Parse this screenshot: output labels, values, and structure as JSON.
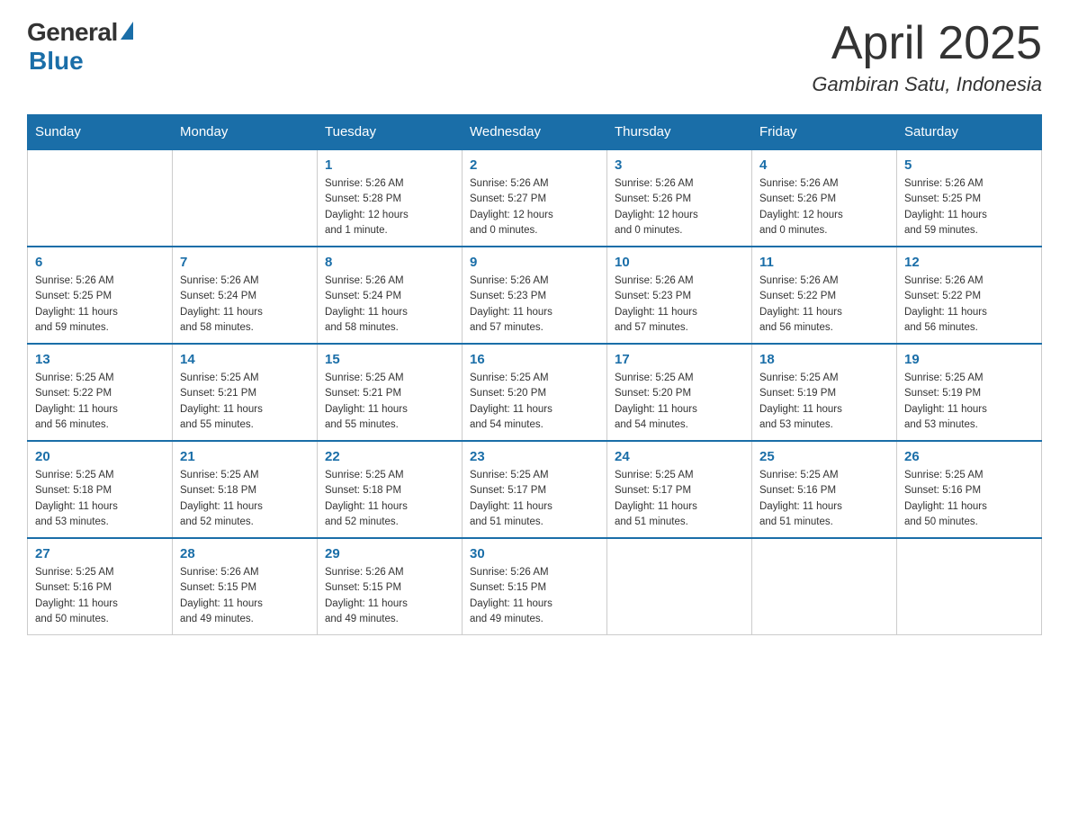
{
  "logo": {
    "general": "General",
    "blue": "Blue",
    "underline": "Blue"
  },
  "header": {
    "month": "April 2025",
    "location": "Gambiran Satu, Indonesia"
  },
  "weekdays": [
    "Sunday",
    "Monday",
    "Tuesday",
    "Wednesday",
    "Thursday",
    "Friday",
    "Saturday"
  ],
  "weeks": [
    [
      {
        "day": "",
        "info": ""
      },
      {
        "day": "",
        "info": ""
      },
      {
        "day": "1",
        "info": "Sunrise: 5:26 AM\nSunset: 5:28 PM\nDaylight: 12 hours\nand 1 minute."
      },
      {
        "day": "2",
        "info": "Sunrise: 5:26 AM\nSunset: 5:27 PM\nDaylight: 12 hours\nand 0 minutes."
      },
      {
        "day": "3",
        "info": "Sunrise: 5:26 AM\nSunset: 5:26 PM\nDaylight: 12 hours\nand 0 minutes."
      },
      {
        "day": "4",
        "info": "Sunrise: 5:26 AM\nSunset: 5:26 PM\nDaylight: 12 hours\nand 0 minutes."
      },
      {
        "day": "5",
        "info": "Sunrise: 5:26 AM\nSunset: 5:25 PM\nDaylight: 11 hours\nand 59 minutes."
      }
    ],
    [
      {
        "day": "6",
        "info": "Sunrise: 5:26 AM\nSunset: 5:25 PM\nDaylight: 11 hours\nand 59 minutes."
      },
      {
        "day": "7",
        "info": "Sunrise: 5:26 AM\nSunset: 5:24 PM\nDaylight: 11 hours\nand 58 minutes."
      },
      {
        "day": "8",
        "info": "Sunrise: 5:26 AM\nSunset: 5:24 PM\nDaylight: 11 hours\nand 58 minutes."
      },
      {
        "day": "9",
        "info": "Sunrise: 5:26 AM\nSunset: 5:23 PM\nDaylight: 11 hours\nand 57 minutes."
      },
      {
        "day": "10",
        "info": "Sunrise: 5:26 AM\nSunset: 5:23 PM\nDaylight: 11 hours\nand 57 minutes."
      },
      {
        "day": "11",
        "info": "Sunrise: 5:26 AM\nSunset: 5:22 PM\nDaylight: 11 hours\nand 56 minutes."
      },
      {
        "day": "12",
        "info": "Sunrise: 5:26 AM\nSunset: 5:22 PM\nDaylight: 11 hours\nand 56 minutes."
      }
    ],
    [
      {
        "day": "13",
        "info": "Sunrise: 5:25 AM\nSunset: 5:22 PM\nDaylight: 11 hours\nand 56 minutes."
      },
      {
        "day": "14",
        "info": "Sunrise: 5:25 AM\nSunset: 5:21 PM\nDaylight: 11 hours\nand 55 minutes."
      },
      {
        "day": "15",
        "info": "Sunrise: 5:25 AM\nSunset: 5:21 PM\nDaylight: 11 hours\nand 55 minutes."
      },
      {
        "day": "16",
        "info": "Sunrise: 5:25 AM\nSunset: 5:20 PM\nDaylight: 11 hours\nand 54 minutes."
      },
      {
        "day": "17",
        "info": "Sunrise: 5:25 AM\nSunset: 5:20 PM\nDaylight: 11 hours\nand 54 minutes."
      },
      {
        "day": "18",
        "info": "Sunrise: 5:25 AM\nSunset: 5:19 PM\nDaylight: 11 hours\nand 53 minutes."
      },
      {
        "day": "19",
        "info": "Sunrise: 5:25 AM\nSunset: 5:19 PM\nDaylight: 11 hours\nand 53 minutes."
      }
    ],
    [
      {
        "day": "20",
        "info": "Sunrise: 5:25 AM\nSunset: 5:18 PM\nDaylight: 11 hours\nand 53 minutes."
      },
      {
        "day": "21",
        "info": "Sunrise: 5:25 AM\nSunset: 5:18 PM\nDaylight: 11 hours\nand 52 minutes."
      },
      {
        "day": "22",
        "info": "Sunrise: 5:25 AM\nSunset: 5:18 PM\nDaylight: 11 hours\nand 52 minutes."
      },
      {
        "day": "23",
        "info": "Sunrise: 5:25 AM\nSunset: 5:17 PM\nDaylight: 11 hours\nand 51 minutes."
      },
      {
        "day": "24",
        "info": "Sunrise: 5:25 AM\nSunset: 5:17 PM\nDaylight: 11 hours\nand 51 minutes."
      },
      {
        "day": "25",
        "info": "Sunrise: 5:25 AM\nSunset: 5:16 PM\nDaylight: 11 hours\nand 51 minutes."
      },
      {
        "day": "26",
        "info": "Sunrise: 5:25 AM\nSunset: 5:16 PM\nDaylight: 11 hours\nand 50 minutes."
      }
    ],
    [
      {
        "day": "27",
        "info": "Sunrise: 5:25 AM\nSunset: 5:16 PM\nDaylight: 11 hours\nand 50 minutes."
      },
      {
        "day": "28",
        "info": "Sunrise: 5:26 AM\nSunset: 5:15 PM\nDaylight: 11 hours\nand 49 minutes."
      },
      {
        "day": "29",
        "info": "Sunrise: 5:26 AM\nSunset: 5:15 PM\nDaylight: 11 hours\nand 49 minutes."
      },
      {
        "day": "30",
        "info": "Sunrise: 5:26 AM\nSunset: 5:15 PM\nDaylight: 11 hours\nand 49 minutes."
      },
      {
        "day": "",
        "info": ""
      },
      {
        "day": "",
        "info": ""
      },
      {
        "day": "",
        "info": ""
      }
    ]
  ]
}
